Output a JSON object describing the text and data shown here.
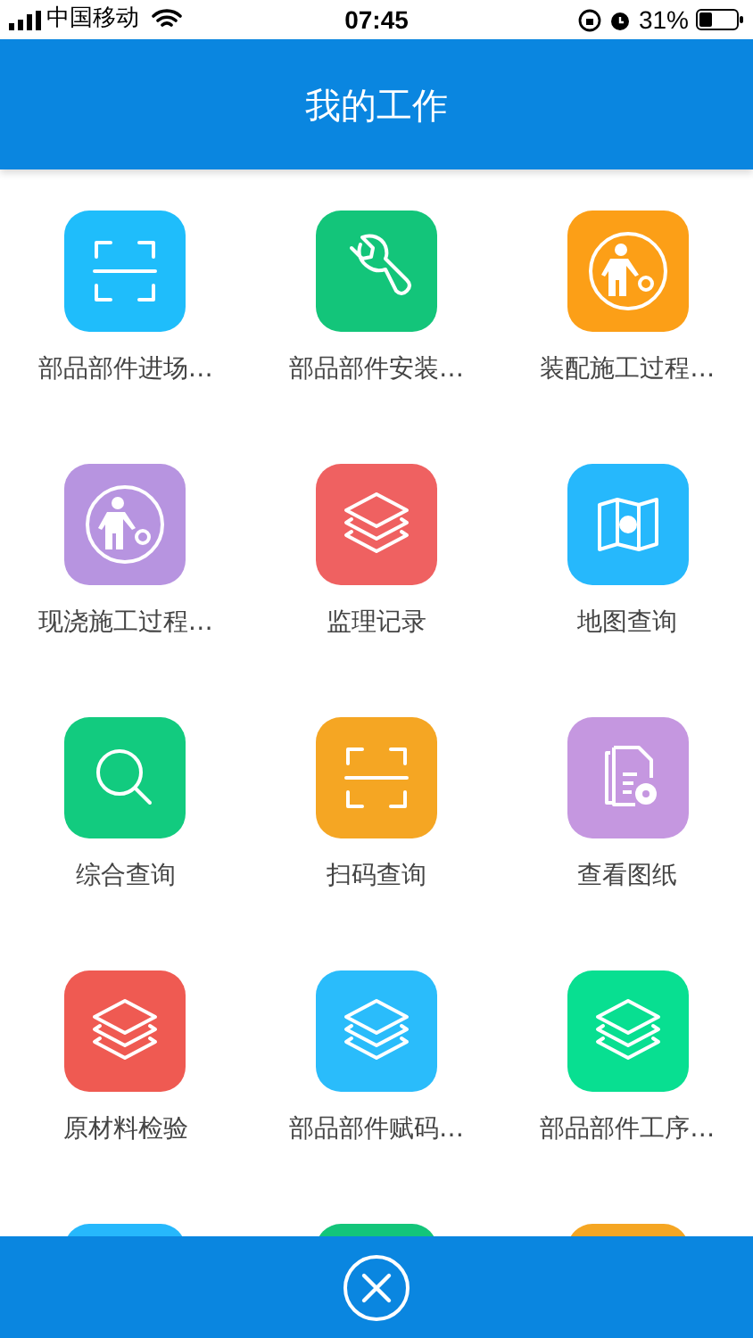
{
  "status_bar": {
    "carrier": "中国移动",
    "time": "07:45",
    "battery": "31%"
  },
  "header": {
    "title": "我的工作"
  },
  "grid": [
    {
      "label": "部品部件进场…",
      "kind": "scan",
      "color": "#1fbdfb"
    },
    {
      "label": "部品部件安装…",
      "kind": "wrench",
      "color": "#13c57a"
    },
    {
      "label": "装配施工过程…",
      "kind": "worker",
      "color": "#fc9f17"
    },
    {
      "label": "现浇施工过程…",
      "kind": "worker",
      "color": "#b794e0"
    },
    {
      "label": "监理记录",
      "kind": "layers",
      "color": "#ef6161"
    },
    {
      "label": "地图查询",
      "kind": "map",
      "color": "#26b8fc"
    },
    {
      "label": "综合查询",
      "kind": "search",
      "color": "#12cb7f"
    },
    {
      "label": "扫码查询",
      "kind": "scan",
      "color": "#f5a623"
    },
    {
      "label": "查看图纸",
      "kind": "document",
      "color": "#c597e0"
    },
    {
      "label": "原材料检验",
      "kind": "layers",
      "color": "#ef5a52"
    },
    {
      "label": "部品部件赋码…",
      "kind": "layers",
      "color": "#2abcfb"
    },
    {
      "label": "部品部件工序…",
      "kind": "layers",
      "color": "#08df91"
    },
    {
      "color": "#26b8fc"
    },
    {
      "color": "#13c57a"
    },
    {
      "color": "#f5a623"
    }
  ]
}
